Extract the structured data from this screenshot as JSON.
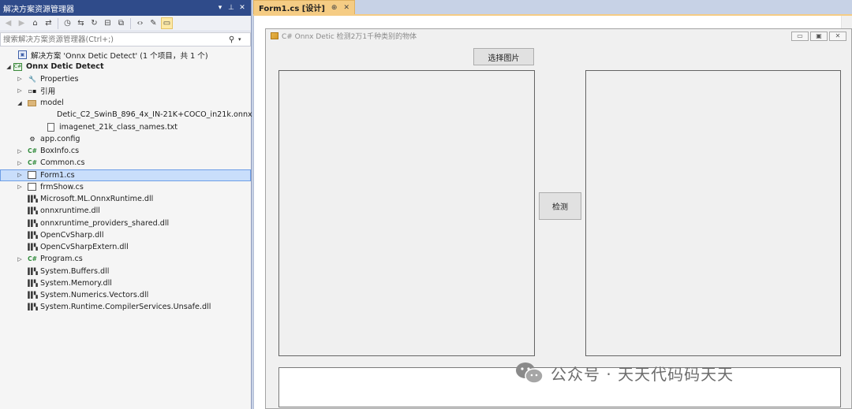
{
  "solution_explorer": {
    "title": "解决方案资源管理器",
    "title_controls": [
      "▾",
      "📌",
      "✕"
    ],
    "search_placeholder": "搜索解决方案资源管理器(Ctrl+;)",
    "tree": [
      {
        "label": "解决方案 'Onnx Detic Detect' (1 个项目，共 1 个)",
        "icon": "solution-icon",
        "indent": 0,
        "expander": ""
      },
      {
        "label": "Onnx Detic Detect",
        "icon": "csharp-project-icon",
        "indent": 0,
        "expander": "◢",
        "bold": true
      },
      {
        "label": "Properties",
        "icon": "wrench-icon",
        "indent": 1,
        "expander": "▷"
      },
      {
        "label": "引用",
        "icon": "references-icon",
        "indent": 1,
        "expander": "▷"
      },
      {
        "label": "model",
        "icon": "folder-icon",
        "indent": 1,
        "expander": "◢"
      },
      {
        "label": "Detic_C2_SwinB_896_4x_IN-21K+COCO_in21k.onnx",
        "icon": "none",
        "indent": 2,
        "expander": ""
      },
      {
        "label": "imagenet_21k_class_names.txt",
        "icon": "file-icon",
        "indent": 2,
        "expander": ""
      },
      {
        "label": "app.config",
        "icon": "config-icon",
        "indent": 1,
        "expander": ""
      },
      {
        "label": "BoxInfo.cs",
        "icon": "csharp-file-icon",
        "indent": 1,
        "expander": "▷"
      },
      {
        "label": "Common.cs",
        "icon": "csharp-file-icon",
        "indent": 1,
        "expander": "▷"
      },
      {
        "label": "Form1.cs",
        "icon": "form-icon",
        "indent": 1,
        "expander": "▷",
        "selected": true
      },
      {
        "label": "frmShow.cs",
        "icon": "form-icon",
        "indent": 1,
        "expander": "▷"
      },
      {
        "label": "Microsoft.ML.OnnxRuntime.dll",
        "icon": "dll-icon",
        "indent": 1,
        "expander": ""
      },
      {
        "label": "onnxruntime.dll",
        "icon": "dll-icon",
        "indent": 1,
        "expander": ""
      },
      {
        "label": "onnxruntime_providers_shared.dll",
        "icon": "dll-icon",
        "indent": 1,
        "expander": ""
      },
      {
        "label": "OpenCvSharp.dll",
        "icon": "dll-icon",
        "indent": 1,
        "expander": ""
      },
      {
        "label": "OpenCvSharpExtern.dll",
        "icon": "dll-icon",
        "indent": 1,
        "expander": ""
      },
      {
        "label": "Program.cs",
        "icon": "csharp-file-icon",
        "indent": 1,
        "expander": "▷"
      },
      {
        "label": "System.Buffers.dll",
        "icon": "dll-icon",
        "indent": 1,
        "expander": ""
      },
      {
        "label": "System.Memory.dll",
        "icon": "dll-icon",
        "indent": 1,
        "expander": ""
      },
      {
        "label": "System.Numerics.Vectors.dll",
        "icon": "dll-icon",
        "indent": 1,
        "expander": ""
      },
      {
        "label": "System.Runtime.CompilerServices.Unsafe.dll",
        "icon": "dll-icon",
        "indent": 1,
        "expander": ""
      }
    ]
  },
  "editor": {
    "tab_label": "Form1.cs [设计]",
    "tab_pin": "⊕",
    "tab_close": "✕"
  },
  "form": {
    "title": "C# Onnx Detic 检测2万1千种类别的物体",
    "select_button": "选择图片",
    "detect_button": "检测"
  },
  "watermark": {
    "text": "公众号 · 天天代码码天天"
  }
}
